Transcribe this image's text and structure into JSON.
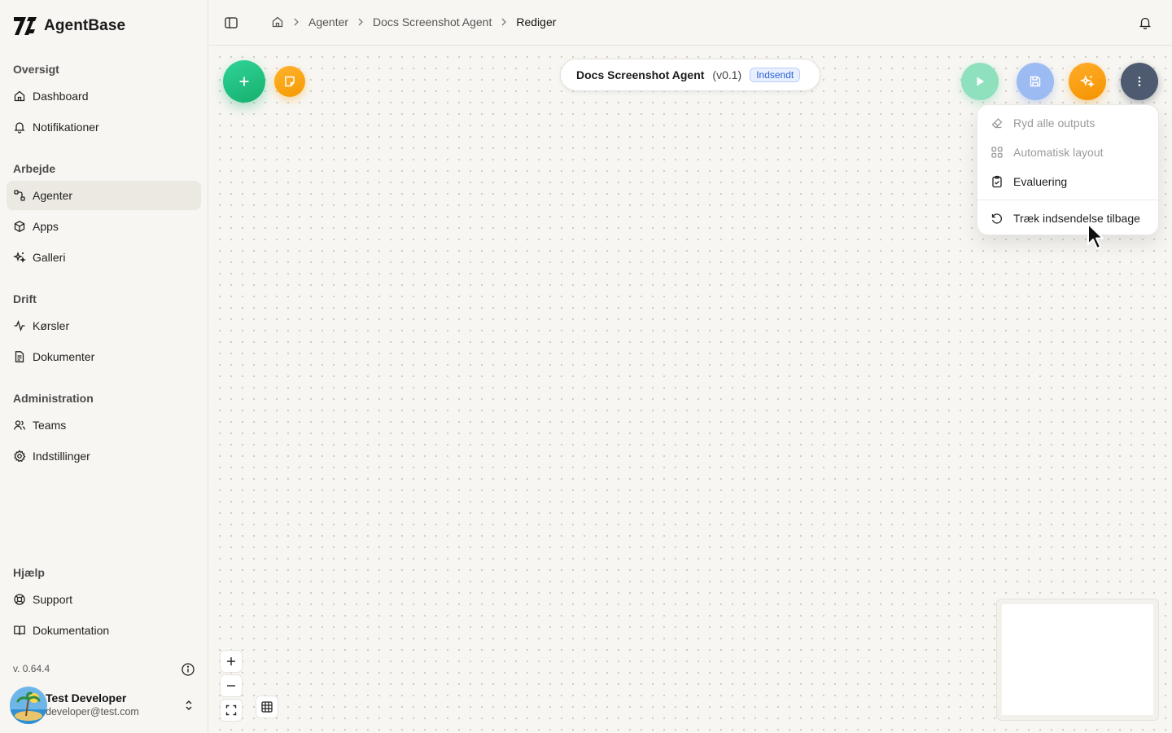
{
  "app": {
    "name": "AgentBase",
    "version": "v. 0.64.4"
  },
  "sidebar": {
    "groups": [
      {
        "title": "Oversigt",
        "items": [
          {
            "label": "Dashboard",
            "icon": "home-icon"
          },
          {
            "label": "Notifikationer",
            "icon": "bell-icon"
          }
        ]
      },
      {
        "title": "Arbejde",
        "items": [
          {
            "label": "Agenter",
            "icon": "workflow-icon",
            "active": true
          },
          {
            "label": "Apps",
            "icon": "cube-icon"
          },
          {
            "label": "Galleri",
            "icon": "sparkles-icon"
          }
        ]
      },
      {
        "title": "Drift",
        "items": [
          {
            "label": "Kørsler",
            "icon": "activity-icon"
          },
          {
            "label": "Dokumenter",
            "icon": "document-icon"
          }
        ]
      },
      {
        "title": "Administration",
        "items": [
          {
            "label": "Teams",
            "icon": "users-icon"
          },
          {
            "label": "Indstillinger",
            "icon": "gear-icon"
          }
        ]
      },
      {
        "title": "Hjælp",
        "items": [
          {
            "label": "Support",
            "icon": "lifebuoy-icon"
          },
          {
            "label": "Dokumentation",
            "icon": "book-icon"
          }
        ]
      }
    ],
    "user": {
      "name": "Test Developer",
      "email": "developer@test.com"
    }
  },
  "breadcrumb": {
    "items": [
      "Agenter",
      "Docs Screenshot Agent"
    ],
    "current": "Rediger"
  },
  "agent": {
    "title": "Docs Screenshot Agent",
    "version": "(v0.1)",
    "status": "Indsendt"
  },
  "menu": {
    "items": [
      {
        "label": "Ryd alle outputs",
        "icon": "eraser-icon",
        "disabled": true
      },
      {
        "label": "Automatisk layout",
        "icon": "layout-grid-icon",
        "disabled": true
      },
      {
        "label": "Evaluering",
        "icon": "clipboard-check-icon",
        "disabled": false
      },
      {
        "label": "Træk indsendelse tilbage",
        "icon": "undo-icon",
        "disabled": false
      }
    ]
  },
  "colors": {
    "add": "#16b06f",
    "note": "#f59a00",
    "run": "#8fe0bd",
    "save": "#9dbbf3",
    "ai": "#f59300",
    "more": "#4e5a70",
    "badge": "#2b5fd9"
  }
}
